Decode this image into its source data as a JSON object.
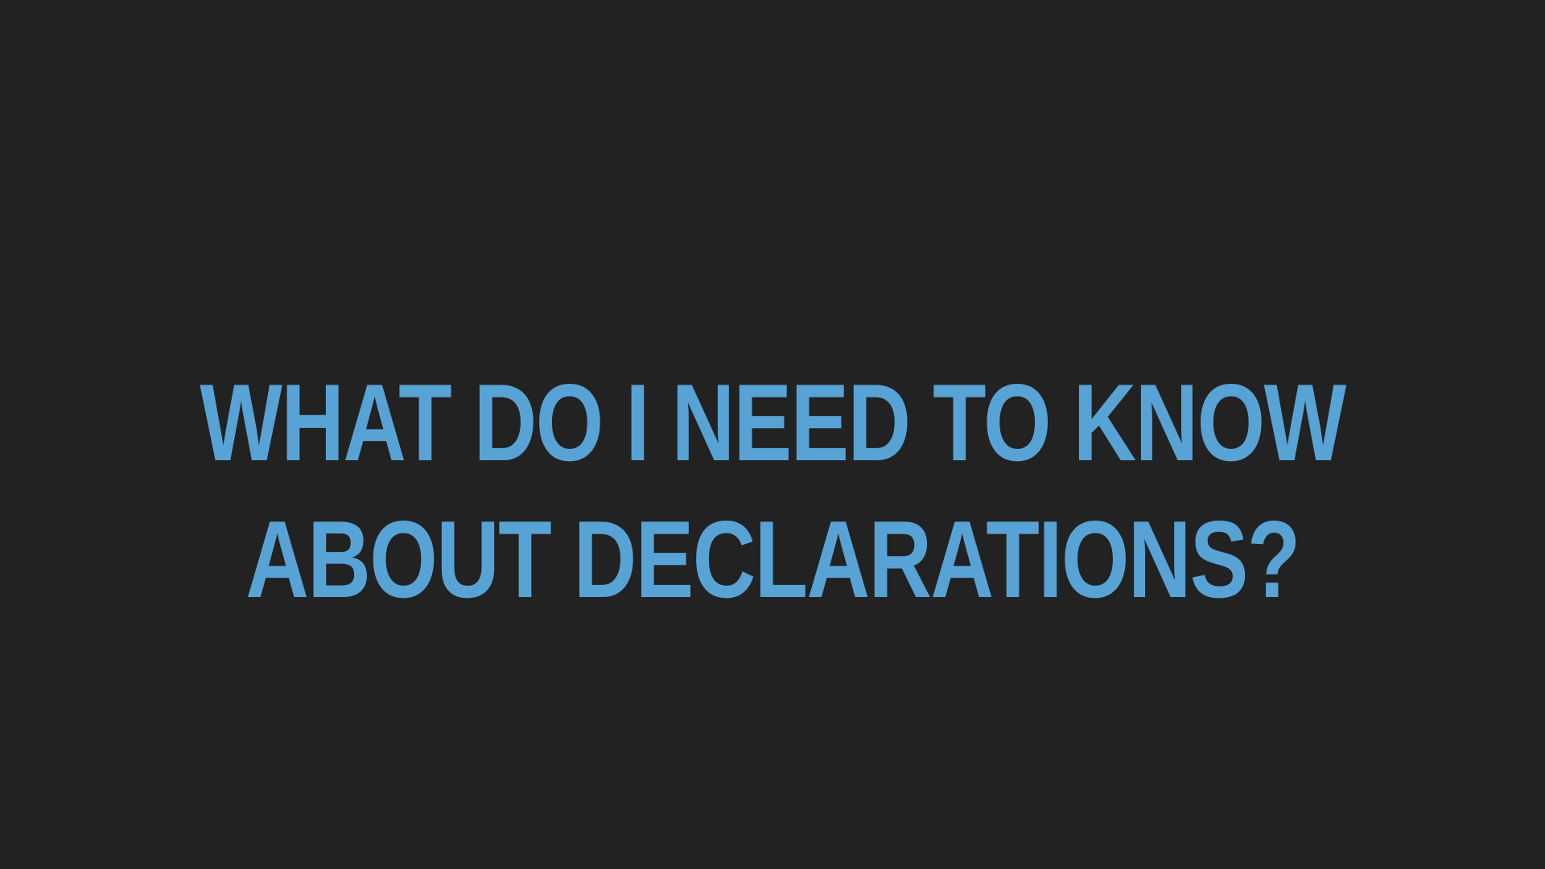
{
  "slide": {
    "title_lines": [
      "WHAT DO I NEED TO KNOW",
      "ABOUT DECLARATIONS?"
    ]
  },
  "colors": {
    "background": "#222222",
    "title": "#58a3d5"
  }
}
